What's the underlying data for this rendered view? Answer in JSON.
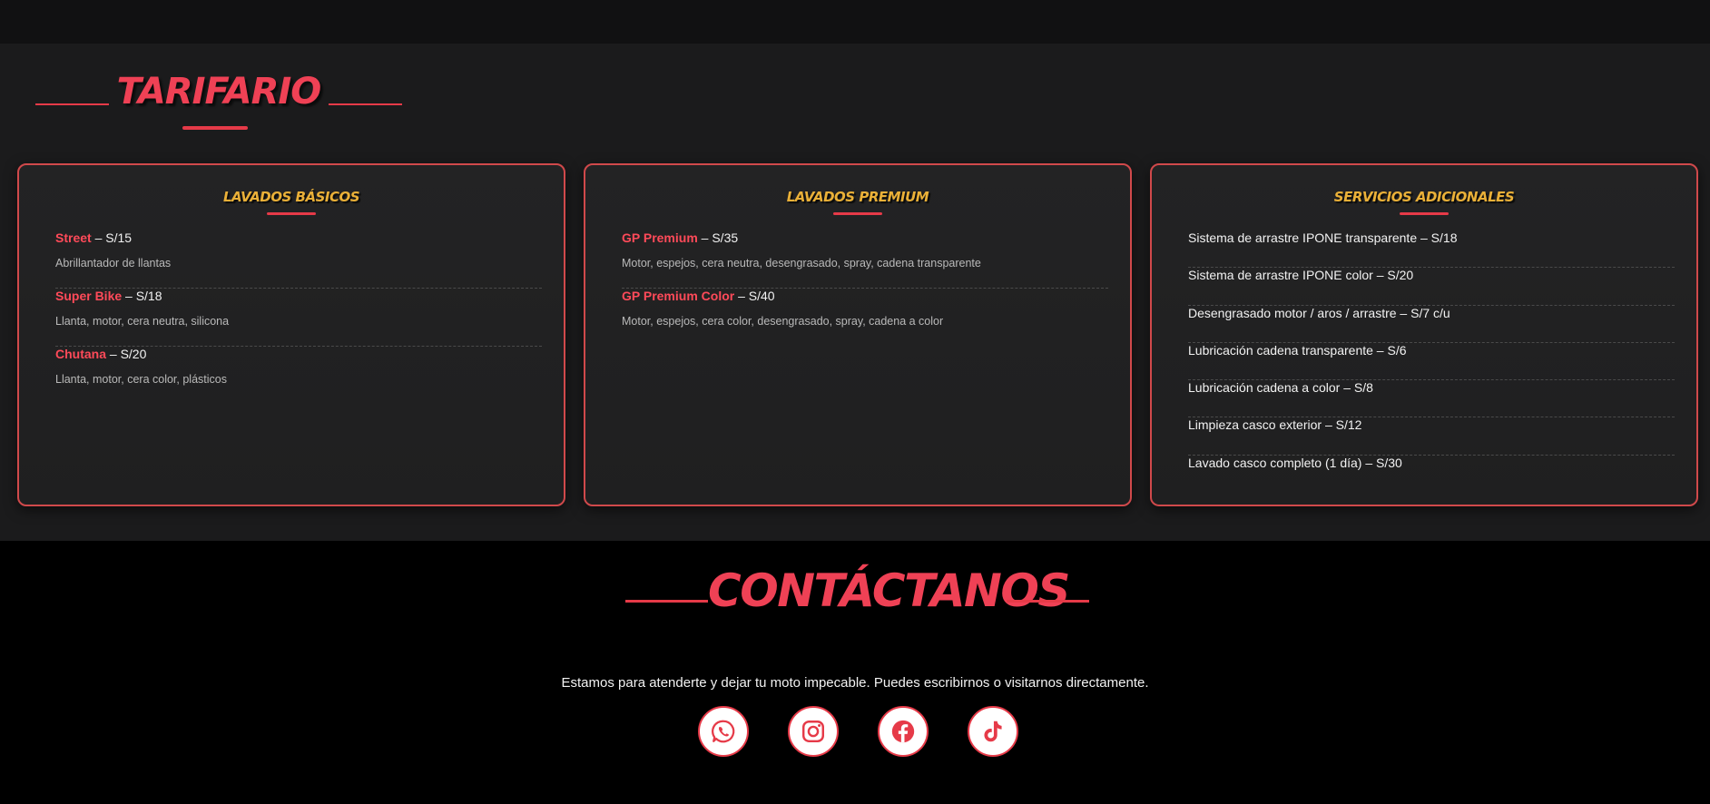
{
  "tarifario": {
    "title": "TARIFARIO",
    "cards": [
      {
        "title": "LAVADOS BÁSICOS",
        "items": [
          {
            "name": "Street",
            "price": " – S/15",
            "desc": "Abrillantador de llantas"
          },
          {
            "name": "Super Bike",
            "price": " – S/18",
            "desc": "Llanta, motor, cera neutra, silicona"
          },
          {
            "name": "Chutana",
            "price": " – S/20",
            "desc": "Llanta, motor, cera color, plásticos"
          }
        ]
      },
      {
        "title": "LAVADOS PREMIUM",
        "items": [
          {
            "name": "GP Premium",
            "price": " – S/35",
            "desc": "Motor, espejos, cera neutra, desengrasado, spray, cadena transparente"
          },
          {
            "name": "GP Premium Color",
            "price": " – S/40",
            "desc": "Motor, espejos, cera color, desengrasado, spray, cadena a color"
          }
        ]
      },
      {
        "title": "SERVICIOS ADICIONALES",
        "items": [
          "Sistema de arrastre IPONE transparente – S/18",
          "Sistema de arrastre IPONE color – S/20",
          "Desengrasado motor / aros / arrastre – S/7 c/u",
          "Lubricación cadena transparente – S/6",
          "Lubricación cadena a color – S/8",
          "Limpieza casco exterior – S/12",
          "Lavado casco completo (1 día) – S/30"
        ]
      }
    ]
  },
  "contact": {
    "title": "CONTÁCTANOS",
    "text": "Estamos para atenderte y dejar tu moto impecable. Puedes escribirnos o visitarnos directamente.",
    "socials": [
      "whatsapp-icon",
      "instagram-icon",
      "facebook-icon",
      "tiktok-icon"
    ]
  },
  "colors": {
    "accent": "#e63a48",
    "gold": "#eab038",
    "background": "#1b1b1c"
  }
}
